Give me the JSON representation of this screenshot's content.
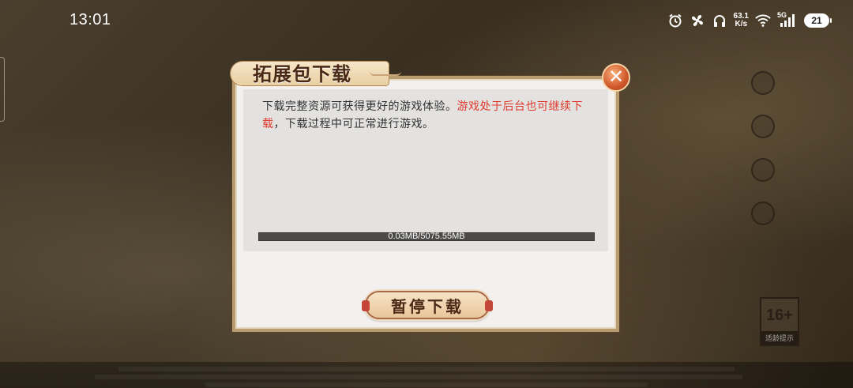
{
  "status_bar": {
    "time": "13:01",
    "net_speed_value": "63.1",
    "net_speed_unit": "K/s",
    "network_tag": "5G",
    "battery": "21",
    "icons": [
      "alarm-icon",
      "fan-icon",
      "headphones-icon",
      "wifi-icon",
      "signal-icon",
      "battery-icon"
    ]
  },
  "dialog": {
    "title": "拓展包下载",
    "description_normal_1": "下载完整资源可获得更好的游戏体验。",
    "description_highlight": "游戏处于后台也可继续下载",
    "description_normal_2": "，下载过程中可正常进行游戏。",
    "progress_text": "0.03MB/5075.55MB",
    "progress_fraction": 5.9e-06,
    "pause_label": "暂停下载",
    "close_icon": "close-icon",
    "highlight_color": "#e03a2c"
  },
  "background": {
    "age_rating": "16+",
    "age_label": "适龄提示"
  }
}
